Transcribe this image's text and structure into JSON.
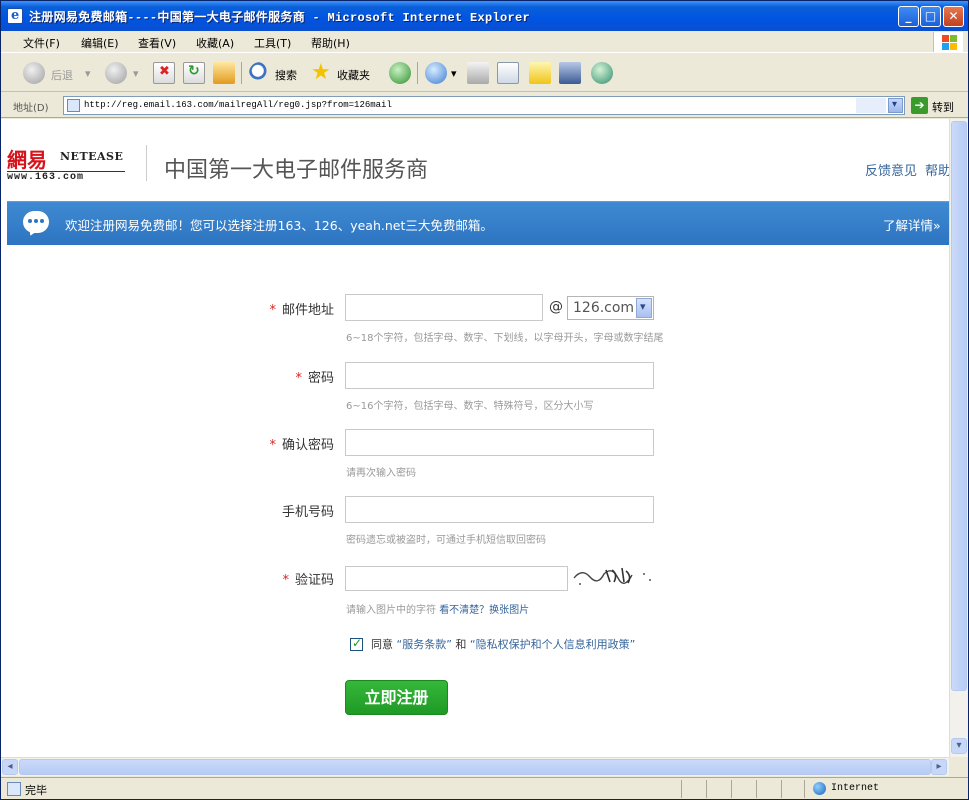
{
  "window": {
    "title": "注册网易免费邮箱----中国第一大电子邮件服务商 - Microsoft Internet Explorer",
    "buttons": {
      "min": "_",
      "max": "□",
      "close": "✕"
    }
  },
  "menu": [
    "文件(F)",
    "编辑(E)",
    "查看(V)",
    "收藏(A)",
    "工具(T)",
    "帮助(H)"
  ],
  "toolbar": {
    "back": "后退",
    "search": "搜索",
    "favorites": "收藏夹"
  },
  "address": {
    "label": "地址(D)",
    "url": "http://reg.email.163.com/mailregAll/reg0.jsp?from=126mail",
    "go": "转到"
  },
  "header": {
    "logo_cn": "網易",
    "logo_en": "NETEASE",
    "logo_url": "www.163.com",
    "slogan": "中国第一大电子邮件服务商",
    "links": [
      "反馈意见",
      "帮助"
    ]
  },
  "banner": {
    "text": "欢迎注册网易免费邮！您可以选择注册163、126、yeah.net三大免费邮箱。",
    "more": "了解详情»"
  },
  "form": {
    "email": {
      "label": "邮件地址",
      "at": "@",
      "domain": "126.com",
      "hint": "6~18个字符，包括字母、数字、下划线，以字母开头，字母或数字结尾"
    },
    "password": {
      "label": "密码",
      "hint": "6~16个字符，包括字母、数字、特殊符号，区分大小写"
    },
    "confirm": {
      "label": "确认密码",
      "hint": "请再次输入密码"
    },
    "phone": {
      "label": "手机号码",
      "hint": "密码遗忘或被盗时，可通过手机短信取回密码"
    },
    "captcha": {
      "label": "验证码",
      "hint": "请输入图片中的字符",
      "refresh": "看不清楚？换张图片"
    },
    "agree": {
      "prefix": "同意",
      "terms": "“服务条款”",
      "and": "和",
      "privacy": "“隐私权保护和个人信息利用政策”"
    },
    "required_mark": "*",
    "submit": "立即注册"
  },
  "status": {
    "text": "完毕",
    "zone": "Internet"
  },
  "colors": {
    "banner": "#2d74c1",
    "submit": "#1f9a25",
    "link": "#35659b",
    "required": "#dd2222"
  }
}
